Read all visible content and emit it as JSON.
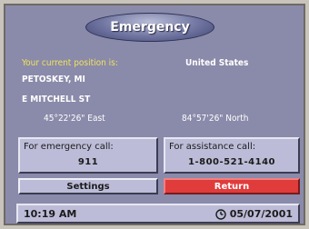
{
  "window": {
    "title": "Emergency"
  },
  "position": {
    "prompt": "Your current position is:",
    "country": "United States",
    "city": "PETOSKEY, MI",
    "street": "E MITCHELL ST",
    "longitude": "45°22'26\" East",
    "latitude": "84°57'26\" North"
  },
  "emergency": {
    "label": "For emergency call:",
    "number": "911"
  },
  "assistance": {
    "label": "For assistance call:",
    "number": "1-800-521-4140"
  },
  "buttons": {
    "settings": "Settings",
    "return": "Return"
  },
  "status": {
    "time": "10:19 AM",
    "date": "05/07/2001",
    "clock_icon": "clock-icon"
  },
  "colors": {
    "frame": "#8a8aaa",
    "accent_yellow": "#f2e25a",
    "return_red": "#e03c3c",
    "card": "#bcbcd8"
  }
}
